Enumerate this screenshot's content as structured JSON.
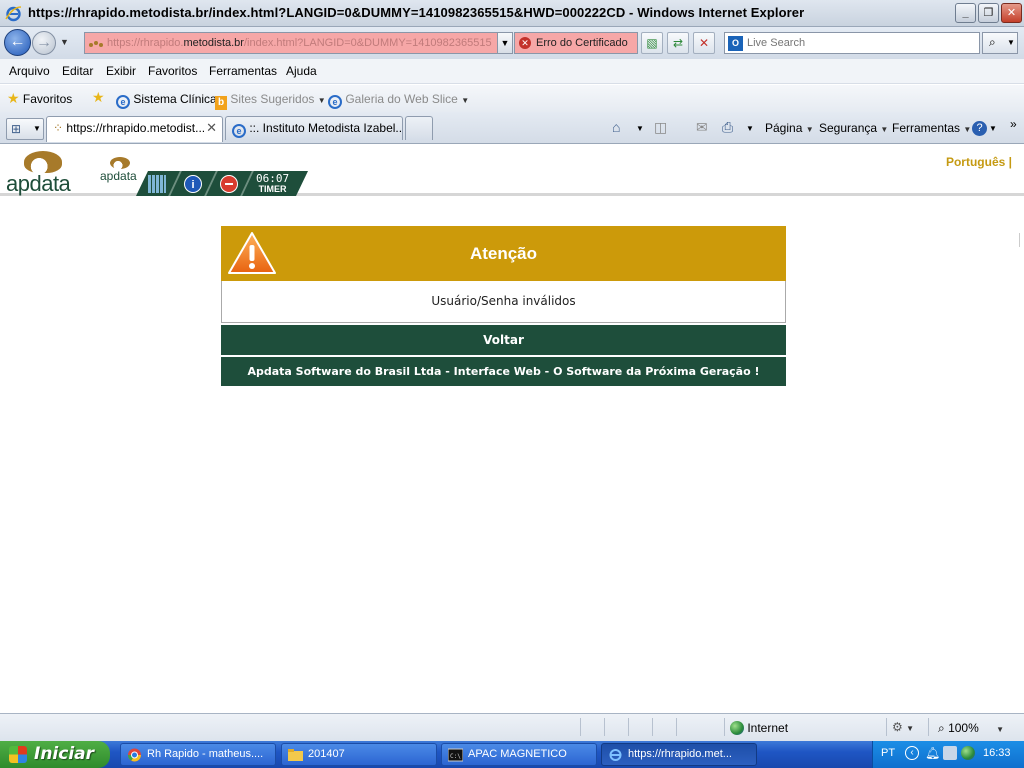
{
  "window": {
    "title": "https://rhrapido.metodista.br/index.html?LANGID=0&DUMMY=1410982365515&HWD=000222CD - Windows Internet Explorer"
  },
  "address_bar": {
    "url_prefix": "https://rhrapido.",
    "url_domain": "metodista.br",
    "url_suffix": "/index.html?LANGID=0&DUMMY=1410982365515",
    "certificate_error": "Erro do Certificado",
    "search_placeholder": "Live Search"
  },
  "menu": [
    "Arquivo",
    "Editar",
    "Exibir",
    "Favoritos",
    "Ferramentas",
    "Ajuda"
  ],
  "favorites_bar": {
    "favorites_label": "Favoritos",
    "items": [
      "Sistema Clínica",
      "Sites Sugeridos",
      "Galeria do Web Slice"
    ]
  },
  "tabs": [
    {
      "label": "https://rhrapido.metodist..."
    },
    {
      "label": "::. Instituto Metodista Izabel..."
    }
  ],
  "command_bar": [
    "Página",
    "Segurança",
    "Ferramentas"
  ],
  "app": {
    "logo_text": "apdata",
    "small_logo_text": "apdata",
    "timer_value": "06:07",
    "timer_label": "TIMER",
    "language_link": "Português |"
  },
  "alert": {
    "title": "Atenção",
    "message": "Usuário/Senha inválidos",
    "back_button": "Voltar",
    "footer": "Apdata Software do Brasil Ltda - Interface Web - O Software da Próxima Geração !"
  },
  "status_bar": {
    "zone": "Internet",
    "zoom": "100%"
  },
  "taskbar": {
    "start_label": "Iniciar",
    "tasks": [
      "Rh Rapido - matheus....",
      "201407",
      "APAC MAGNETICO",
      "https://rhrapido.met..."
    ],
    "language": "PT",
    "clock": "16:33"
  },
  "colors": {
    "alert_gold": "#cc9a0a",
    "apdata_green": "#1e4e3b",
    "cert_error_red": "#f6a7a7",
    "language_gold": "#c59a12"
  }
}
